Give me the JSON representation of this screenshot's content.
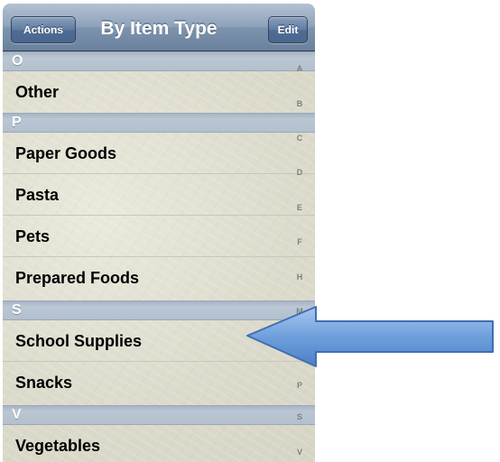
{
  "navbar": {
    "left_button": "Actions",
    "title": "By Item Type",
    "right_button": "Edit"
  },
  "sections": [
    {
      "header": "O",
      "items": [
        "Other"
      ]
    },
    {
      "header": "P",
      "items": [
        "Paper Goods",
        "Pasta",
        "Pets",
        "Prepared Foods"
      ]
    },
    {
      "header": "S",
      "items": [
        "School Supplies",
        "Snacks"
      ]
    },
    {
      "header": "V",
      "items": [
        "Vegetables"
      ]
    }
  ],
  "section_index": [
    "A",
    "B",
    "C",
    "D",
    "E",
    "F",
    "H",
    "M",
    "P",
    "S",
    "V"
  ],
  "colors": {
    "navbar": "#7d93ad",
    "section_header": "#b3c0cd",
    "list_background": "#e2e0d2",
    "arrow_fill": "#5b8fd4"
  },
  "icons": {
    "callout": "left-arrow-icon"
  }
}
